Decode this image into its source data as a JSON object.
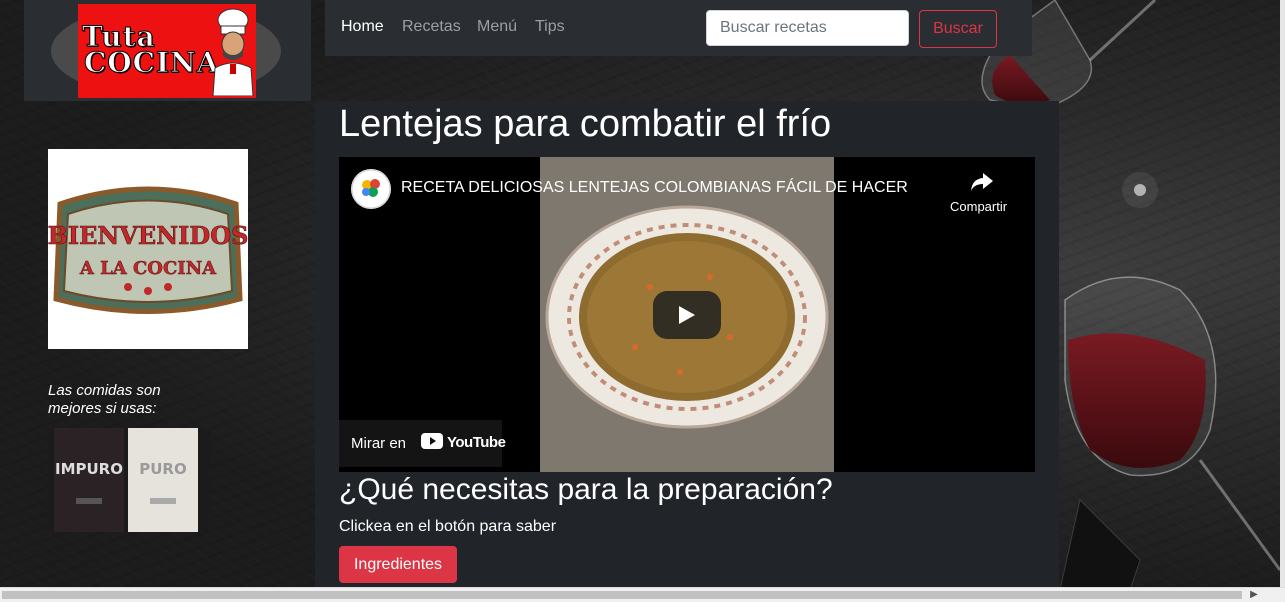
{
  "brand": {
    "line1": "Tuta",
    "line2": "COCINA"
  },
  "nav": {
    "items": [
      {
        "label": "Home",
        "active": true
      },
      {
        "label": "Recetas",
        "active": false
      },
      {
        "label": "Menú",
        "active": false
      },
      {
        "label": "Tips",
        "active": false
      }
    ]
  },
  "search": {
    "placeholder": "Buscar recetas",
    "button_label": "Buscar"
  },
  "sidebar": {
    "welcome_line1": "BIENVENIDOS",
    "welcome_line2": "A LA COCINA",
    "promo_text": "Las comidas son mejores si usas:",
    "wine_labels": [
      "IMPURO",
      "PURO"
    ]
  },
  "main": {
    "title": "Lentejas para combatir el frío",
    "video": {
      "title": "RECETA DELICIOSAS LENTEJAS COLOMBIANAS FÁCIL DE HACER",
      "share_label": "Compartir",
      "watch_on_label": "Mirar en",
      "platform": "YouTube"
    },
    "section_title": "¿Qué necesitas para la preparación?",
    "section_subtitle": "Clickea en el botón para saber",
    "ingredients_button": "Ingredientes"
  },
  "colors": {
    "accent_red": "#dc3545",
    "panel_dark": "#212529",
    "logo_red": "#ee1111"
  }
}
